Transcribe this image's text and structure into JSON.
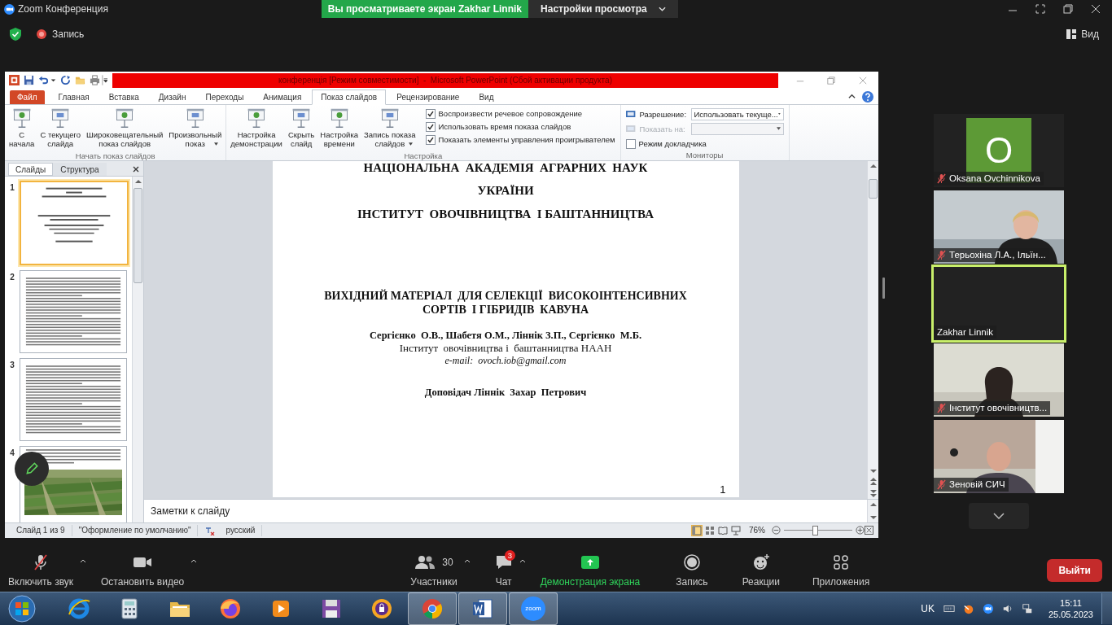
{
  "app_title": "Zoom Конференция",
  "view_banner": {
    "text": "Вы просматриваете экран Zakhar Linnik"
  },
  "view_settings": {
    "label": "Настройки просмотра"
  },
  "recording": {
    "label": "Запись"
  },
  "view_button": {
    "label": "Вид"
  },
  "powerpoint": {
    "title": "конференція [Режим совместимости]  -  Microsoft PowerPoint (Сбой активации продукта)",
    "tabs": [
      {
        "label": "Файл",
        "kind": "file",
        "selected": false
      },
      {
        "label": "Главная",
        "kind": "tab",
        "selected": false
      },
      {
        "label": "Вставка",
        "kind": "tab",
        "selected": false
      },
      {
        "label": "Дизайн",
        "kind": "tab",
        "selected": false
      },
      {
        "label": "Переходы",
        "kind": "tab",
        "selected": false
      },
      {
        "label": "Анимация",
        "kind": "tab",
        "selected": false
      },
      {
        "label": "Показ слайдов",
        "kind": "tab",
        "selected": true
      },
      {
        "label": "Рецензирование",
        "kind": "tab",
        "selected": false
      },
      {
        "label": "Вид",
        "kind": "tab",
        "selected": false
      }
    ],
    "ribbon_groups": [
      {
        "label": "Начать показ слайдов",
        "buttons": [
          {
            "lines": [
              "С",
              "начала"
            ],
            "dropdown": false
          },
          {
            "lines": [
              "С текущего",
              "слайда"
            ],
            "dropdown": false
          },
          {
            "lines": [
              "Широковещательный",
              "показ слайдов"
            ],
            "dropdown": false
          },
          {
            "lines": [
              "Произвольный",
              "показ"
            ],
            "dropdown": true
          }
        ]
      },
      {
        "label": "Настройка",
        "buttons": [
          {
            "lines": [
              "Настройка",
              "демонстрации"
            ],
            "dropdown": false
          },
          {
            "lines": [
              "Скрыть",
              "слайд"
            ],
            "dropdown": false
          },
          {
            "lines": [
              "Настройка",
              "времени"
            ],
            "dropdown": false
          },
          {
            "lines": [
              "Запись показа",
              "слайдов"
            ],
            "dropdown": true
          }
        ],
        "checkboxes": [
          {
            "label": "Воспроизвести речевое сопровождение",
            "checked": true
          },
          {
            "label": "Использовать время показа слайдов",
            "checked": true
          },
          {
            "label": "Показать элементы управления проигрывателем",
            "checked": true
          }
        ]
      },
      {
        "label": "Мониторы",
        "fields": [
          {
            "label": "Разрешение:",
            "value": "Использовать текуще...",
            "disabled": false
          },
          {
            "label": "Показать на:",
            "disabled": true
          }
        ],
        "checkboxes": [
          {
            "label": "Режим докладчика",
            "checked": false
          }
        ]
      }
    ],
    "pane_tabs": [
      {
        "label": "Слайды",
        "selected": true
      },
      {
        "label": "Структура",
        "selected": false
      }
    ],
    "thumbnails": [
      {
        "number": "1",
        "kind": "title",
        "selected": true
      },
      {
        "number": "2",
        "kind": "text",
        "selected": false
      },
      {
        "number": "3",
        "kind": "text",
        "selected": false
      },
      {
        "number": "4",
        "selected": false
      }
    ],
    "slide": {
      "heading_lines": [
        "НАЦІОНАЛЬНА  АКАДЕМІЯ  АГРАРНИХ  НАУК",
        "УКРАЇНИ",
        "ІНСТИТУТ  ОВОЧІВНИЦТВА  І БАШТАННИЦТВА"
      ],
      "title_lines": [
        "ВИХІДНИЙ МАТЕРІАЛ  ДЛЯ СЕЛЕКЦІЇ  ВИСОКОІНТЕНСИВНИХ",
        "СОРТІВ  І ГІБРИДІВ  КАВУНА"
      ],
      "authors": "Сергієнко  О.В., Шабетя О.М., Ліннік З.П., Сергієнко  М.Б.",
      "affiliation": "Інститут  овочівництва і  баштанництва НААН",
      "email": "e-mail:  ovoch.iob@gmail.com",
      "speaker": "Доповідач Ліннік  Захар  Петрович",
      "page_number": "1"
    },
    "notes": {
      "placeholder": "Заметки к слайду"
    },
    "status": {
      "slide": "Слайд 1 из 9",
      "theme": "\"Оформление по умолчанию\"",
      "language": "русский",
      "zoom": "76%",
      "level": 0.45
    }
  },
  "participants": [
    {
      "name": "Oksana Ovchinnikova",
      "kind": "avatar",
      "initial": "O",
      "muted": true,
      "speaking": false
    },
    {
      "name": "Терьохіна Л.А., Ільїн...",
      "kind": "video",
      "muted": true,
      "speaking": false
    },
    {
      "name": "Zakhar Linnik",
      "kind": "blank",
      "muted": false,
      "speaking": true
    },
    {
      "name": "Інститут овочівництв...",
      "kind": "video",
      "muted": true,
      "speaking": false
    },
    {
      "name": "Зеновій СИЧ",
      "kind": "video",
      "muted": true,
      "speaking": false
    }
  ],
  "toolbar": [
    {
      "kind": "mic",
      "label": "Включить звук",
      "muted": true,
      "menu": true,
      "active": false
    },
    {
      "kind": "video",
      "label": "Остановить видео",
      "menu": true,
      "active": false
    },
    {
      "kind": "participants",
      "label": "Участники",
      "count": "30",
      "menu": true,
      "active": false
    },
    {
      "kind": "chat",
      "label": "Чат",
      "badge": "3",
      "menu": true,
      "active": false
    },
    {
      "kind": "share",
      "label": "Демонстрация экрана",
      "menu": false,
      "active": true
    },
    {
      "kind": "record",
      "label": "Запись",
      "menu": false,
      "active": false
    },
    {
      "kind": "reactions",
      "label": "Реакции",
      "menu": false,
      "active": false
    },
    {
      "kind": "apps",
      "label": "Приложения",
      "menu": false,
      "active": false
    }
  ],
  "exit_button": "Выйти",
  "taskbar": {
    "apps": [
      {
        "kind": "ie",
        "active": false
      },
      {
        "kind": "calculator",
        "active": false
      },
      {
        "kind": "explorer",
        "active": false
      },
      {
        "kind": "firefox",
        "active": false
      },
      {
        "kind": "media",
        "active": false
      },
      {
        "kind": "floppy",
        "active": false
      },
      {
        "kind": "lock",
        "active": false
      },
      {
        "kind": "chrome",
        "active": true
      },
      {
        "kind": "word",
        "active": true
      },
      {
        "kind": "zoom",
        "active": true,
        "label": "zoom"
      }
    ],
    "language": "UK",
    "time": "15:11",
    "date": "25.05.2023"
  }
}
